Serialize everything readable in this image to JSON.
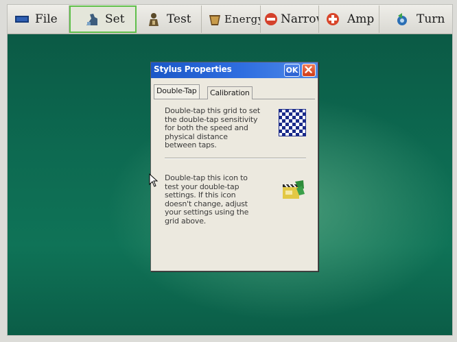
{
  "toolbar": {
    "items": [
      {
        "label": "File",
        "icon": "monitor-icon"
      },
      {
        "label": "Set",
        "icon": "wrench-icon",
        "selected": true
      },
      {
        "label": "Test",
        "icon": "person-icon"
      },
      {
        "label": "Energy",
        "icon": "bucket-icon"
      },
      {
        "label": "Narrow",
        "icon": "minus-circle-icon"
      },
      {
        "label": "Amp",
        "icon": "plus-circle-icon"
      },
      {
        "label": "Turn",
        "icon": "rotate-icon"
      }
    ]
  },
  "dialog": {
    "title": "Stylus Properties",
    "ok_label": "OK",
    "tabs": [
      {
        "label": "Double-Tap",
        "active": true
      },
      {
        "label": "Calibration",
        "active": false
      }
    ],
    "paragraph1": "Double-tap this grid to set the double-tap sensitivity for both the speed and physical distance between taps.",
    "paragraph2": "Double-tap this icon to test your double-tap settings. If this icon doesn't change, adjust your settings using the grid above."
  },
  "colors": {
    "desktop": "#0f6a50",
    "titlebar": "#2b63d6",
    "selected_border": "#5fbf4a",
    "close_button": "#d9441f"
  }
}
